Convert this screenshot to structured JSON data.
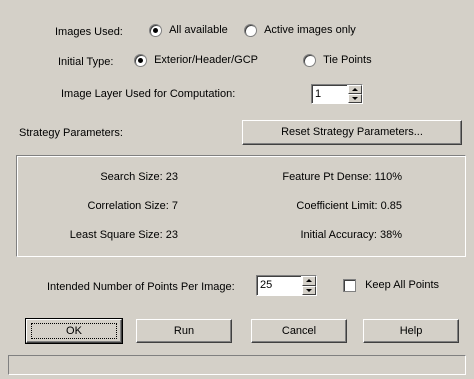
{
  "images_used": {
    "label": "Images Used:",
    "options": [
      "All available",
      "Active images only"
    ],
    "selected": "All available"
  },
  "initial_type": {
    "label": "Initial Type:",
    "options": [
      "Exterior/Header/GCP",
      "Tie Points"
    ],
    "selected": "Exterior/Header/GCP"
  },
  "image_layer": {
    "label": "Image Layer Used for Computation:",
    "value": "1"
  },
  "strategy": {
    "label": "Strategy Parameters:",
    "reset_button": "Reset Strategy Parameters..."
  },
  "params": {
    "search_size": "Search Size: 23",
    "correlation_size": "Correlation Size: 7",
    "least_square_size": "Least Square Size: 23",
    "feature_pt_dense": "Feature Pt Dense: 110%",
    "coefficient_limit": "Coefficient Limit:  0.85",
    "initial_accuracy": "Initial Accuracy: 38%"
  },
  "points": {
    "label": "Intended Number of Points Per Image:",
    "value": "25",
    "keep_all_label": "Keep All Points"
  },
  "buttons": {
    "ok": "OK",
    "run": "Run",
    "cancel": "Cancel",
    "help": "Help"
  }
}
